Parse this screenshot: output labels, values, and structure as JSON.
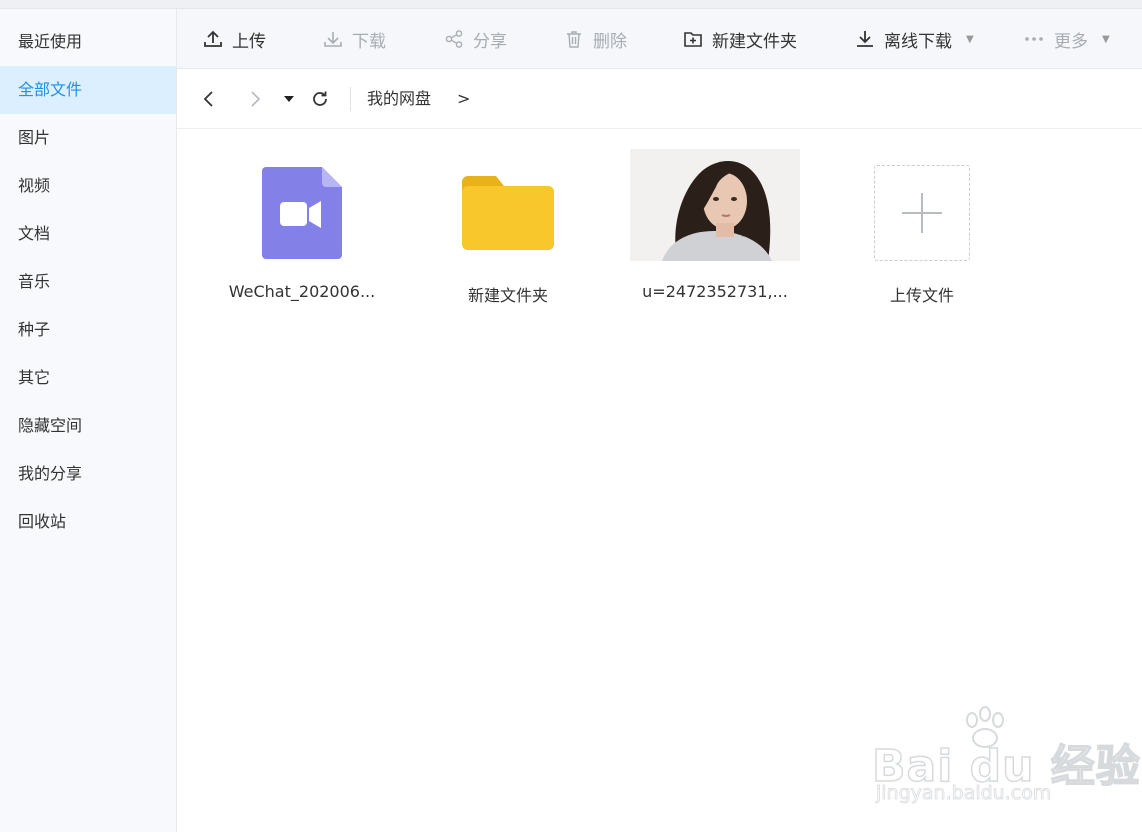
{
  "sidebar": {
    "items": [
      {
        "label": "最近使用",
        "active": false
      },
      {
        "label": "全部文件",
        "active": true
      },
      {
        "label": "图片",
        "active": false
      },
      {
        "label": "视频",
        "active": false
      },
      {
        "label": "文档",
        "active": false
      },
      {
        "label": "音乐",
        "active": false
      },
      {
        "label": "种子",
        "active": false
      },
      {
        "label": "其它",
        "active": false
      },
      {
        "label": "隐藏空间",
        "active": false
      },
      {
        "label": "我的分享",
        "active": false
      },
      {
        "label": "回收站",
        "active": false
      }
    ]
  },
  "toolbar": {
    "upload": "上传",
    "download": "下载",
    "share": "分享",
    "delete": "删除",
    "new_folder": "新建文件夹",
    "offline_download": "离线下载",
    "more": "更多"
  },
  "nav": {
    "breadcrumb": "我的网盘",
    "breadcrumb_arrow": ">"
  },
  "files": [
    {
      "name": "WeChat_202006...",
      "type": "video",
      "icon": "video-file-icon"
    },
    {
      "name": "新建文件夹",
      "type": "folder",
      "icon": "folder-icon"
    },
    {
      "name": "u=2472352731,...",
      "type": "image",
      "icon": "photo-thumbnail"
    },
    {
      "name": "上传文件",
      "type": "upload",
      "icon": "plus-icon"
    }
  ],
  "watermark": {
    "brand": "Bai du 经验",
    "url": "jingyan.baidu.com"
  },
  "colors": {
    "accent": "#1e90e6",
    "active_bg": "#dcefff",
    "video_icon": "#8380e8",
    "folder": "#f7c72c"
  }
}
